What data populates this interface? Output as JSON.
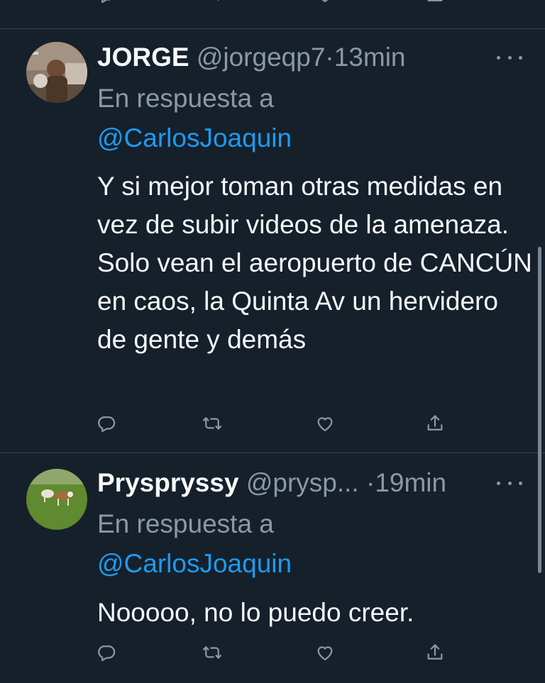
{
  "tweets": [
    {
      "author_name": "JORGE",
      "handle": "@jorgeqp7",
      "separator": "·",
      "time": "13min",
      "reply_prefix": "En respuesta a",
      "reply_to": "@CarlosJoaquin",
      "text": "Y si mejor toman otras medidas en vez de subir videos de la amenaza. Solo vean el aeropuerto de CANCÚN en caos, la Quinta Av un hervidero de gente y demás"
    },
    {
      "author_name": "Pryspryssy",
      "handle": "@prysp...",
      "separator": "·",
      "time": "19min",
      "reply_prefix": "En respuesta a",
      "reply_to": "@CarlosJoaquin",
      "text": "Nooooo, no lo puedo creer."
    }
  ],
  "icons": {
    "reply": "reply-icon",
    "retweet": "retweet-icon",
    "like": "like-icon",
    "share": "share-icon",
    "more": "more-icon"
  },
  "colors": {
    "background": "#15202b",
    "text": "#f7f9f9",
    "secondary": "#8b98a5",
    "link": "#1d9bf0",
    "divider": "#38444d"
  }
}
